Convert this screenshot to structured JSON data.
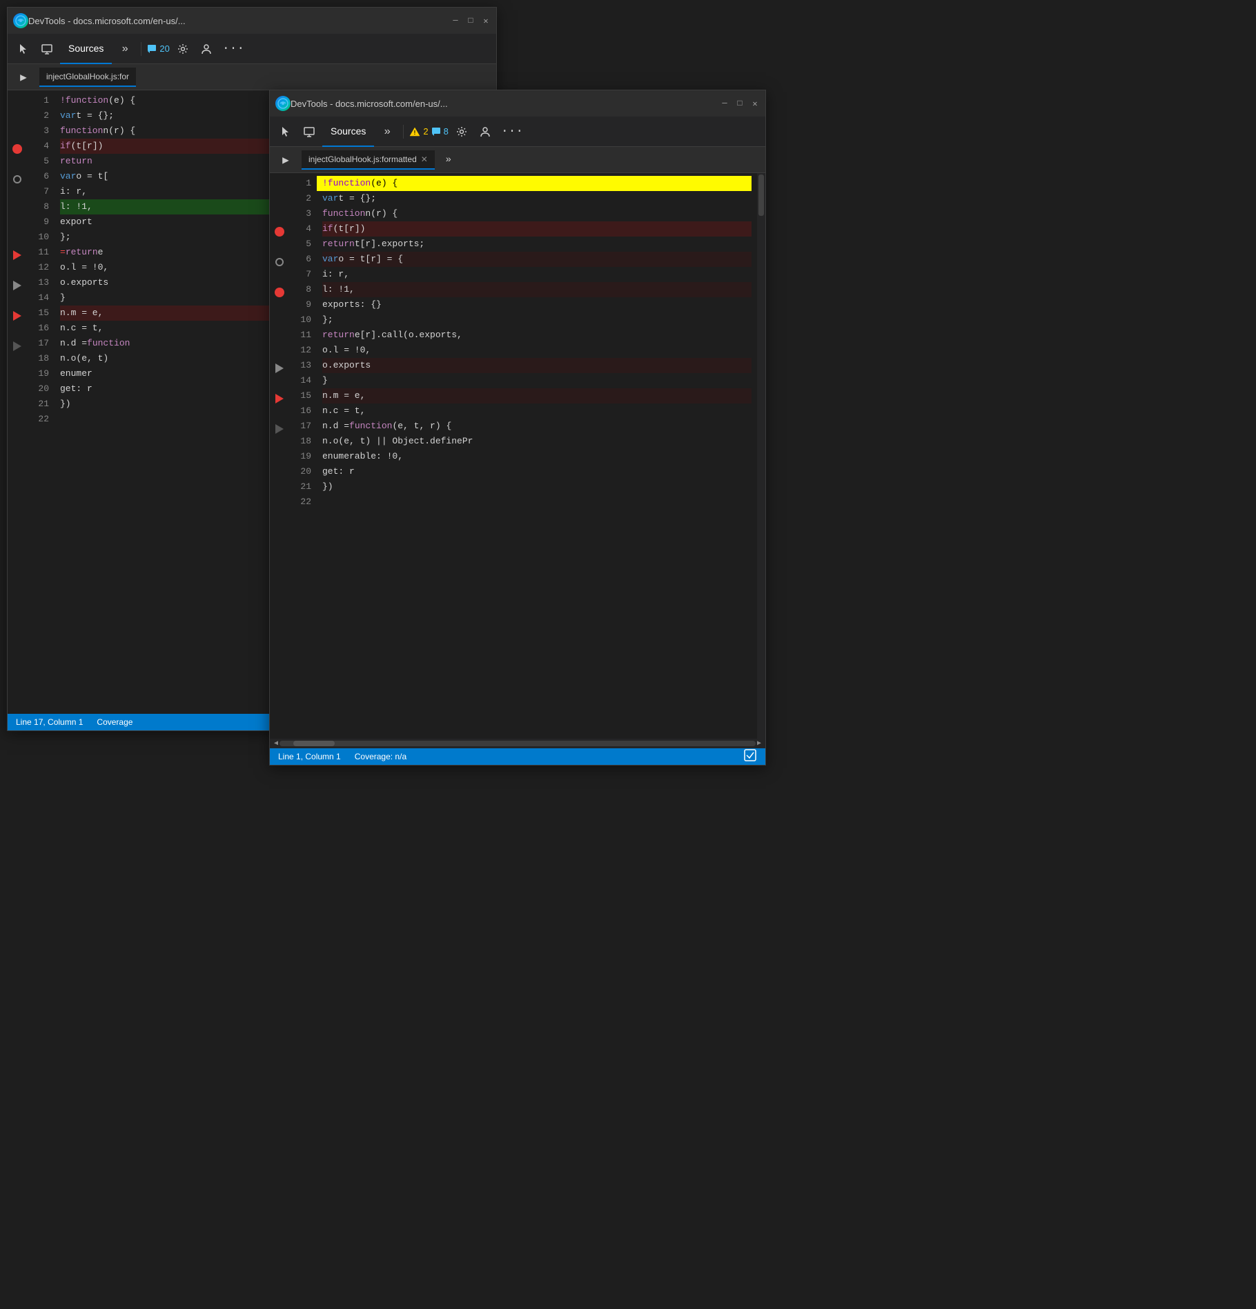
{
  "window_back": {
    "title": "DevTools - docs.microsoft.com/en-us/...",
    "tab_sources": "Sources",
    "badge_count": "20",
    "file_tab_name": "injectGlobalHook.js:for",
    "status_position": "Line 17, Column 1",
    "status_coverage": "Coverage",
    "code_lines": [
      {
        "num": 1,
        "bp": "none",
        "highlight": "none",
        "content": "!function(e) {"
      },
      {
        "num": 2,
        "bp": "none",
        "highlight": "none",
        "content": "    var t = {};"
      },
      {
        "num": 3,
        "bp": "none",
        "highlight": "none",
        "content": "    function n(r) {"
      },
      {
        "num": 4,
        "bp": "red",
        "highlight": "breakpoint",
        "content": "        if (t[r])"
      },
      {
        "num": 5,
        "bp": "none",
        "highlight": "none",
        "content": "            return"
      },
      {
        "num": 6,
        "bp": "gray",
        "highlight": "none",
        "content": "        var o = t["
      },
      {
        "num": 7,
        "bp": "none",
        "highlight": "none",
        "content": "            i: r,"
      },
      {
        "num": 8,
        "bp": "none",
        "highlight": "green",
        "content": "            l: !1,"
      },
      {
        "num": 9,
        "bp": "none",
        "highlight": "none",
        "content": "            export"
      },
      {
        "num": 10,
        "bp": "none",
        "highlight": "none",
        "content": "        };"
      },
      {
        "num": 11,
        "bp": "arrow-red",
        "highlight": "none",
        "content": "=return e"
      },
      {
        "num": 12,
        "bp": "none",
        "highlight": "none",
        "content": "        o.l = !0,"
      },
      {
        "num": 13,
        "bp": "arrow-gray",
        "highlight": "none",
        "content": "        o.exports"
      },
      {
        "num": 14,
        "bp": "none",
        "highlight": "none",
        "content": "    }"
      },
      {
        "num": 15,
        "bp": "arrow-red",
        "highlight": "breakpoint",
        "content": "    n.m = e,"
      },
      {
        "num": 16,
        "bp": "none",
        "highlight": "none",
        "content": "    n.c = t,"
      },
      {
        "num": 17,
        "bp": "arrow-outline",
        "highlight": "none",
        "content": "    n.d = function"
      },
      {
        "num": 18,
        "bp": "none",
        "highlight": "none",
        "content": "        n.o(e, t)"
      },
      {
        "num": 19,
        "bp": "none",
        "highlight": "none",
        "content": "            enumer"
      },
      {
        "num": 20,
        "bp": "none",
        "highlight": "none",
        "content": "            get: r"
      },
      {
        "num": 21,
        "bp": "none",
        "highlight": "none",
        "content": "    })"
      },
      {
        "num": 22,
        "bp": "none",
        "highlight": "none",
        "content": ""
      }
    ]
  },
  "window_front": {
    "title": "DevTools - docs.microsoft.com/en-us/...",
    "tab_sources": "Sources",
    "badge_warning": "2",
    "badge_messages": "8",
    "file_tab_name": "injectGlobalHook.js:formatted",
    "status_position": "Line 1, Column 1",
    "status_coverage": "Coverage: n/a",
    "code_lines": [
      {
        "num": 1,
        "bp": "none",
        "highlight": "yellow",
        "content_parts": [
          {
            "t": "kw",
            "v": "!function"
          },
          {
            "t": "plain",
            "v": "(e) {"
          }
        ]
      },
      {
        "num": 2,
        "bp": "none",
        "highlight": "none",
        "content_parts": [
          {
            "t": "plain",
            "v": "        "
          },
          {
            "t": "kw2",
            "v": "var"
          },
          {
            "t": "plain",
            "v": " t = {};"
          }
        ]
      },
      {
        "num": 3,
        "bp": "none",
        "highlight": "none",
        "content_parts": [
          {
            "t": "plain",
            "v": "        "
          },
          {
            "t": "kw",
            "v": "function"
          },
          {
            "t": "plain",
            "v": " n(r) {"
          }
        ]
      },
      {
        "num": 4,
        "bp": "red",
        "highlight": "breakpoint",
        "content_parts": [
          {
            "t": "plain",
            "v": "            "
          },
          {
            "t": "kw",
            "v": "if"
          },
          {
            "t": "plain",
            "v": " (t[r])"
          }
        ]
      },
      {
        "num": 5,
        "bp": "none",
        "highlight": "none",
        "content_parts": [
          {
            "t": "plain",
            "v": "                "
          },
          {
            "t": "kw",
            "v": "return"
          },
          {
            "t": "plain",
            "v": " t[r].exports;"
          }
        ]
      },
      {
        "num": 6,
        "bp": "gray",
        "highlight": "breakpoint-light",
        "content_parts": [
          {
            "t": "plain",
            "v": "            "
          },
          {
            "t": "kw2",
            "v": "var"
          },
          {
            "t": "plain",
            "v": " o = t[r] = {"
          }
        ]
      },
      {
        "num": 7,
        "bp": "none",
        "highlight": "none",
        "content_parts": [
          {
            "t": "plain",
            "v": "                i: r,"
          }
        ]
      },
      {
        "num": 8,
        "bp": "red",
        "highlight": "breakpoint-light",
        "content_parts": [
          {
            "t": "plain",
            "v": "                l: !1,"
          }
        ]
      },
      {
        "num": 9,
        "bp": "none",
        "highlight": "none",
        "content_parts": [
          {
            "t": "plain",
            "v": "                exports: {}"
          }
        ]
      },
      {
        "num": 10,
        "bp": "none",
        "highlight": "none",
        "content_parts": [
          {
            "t": "plain",
            "v": "            };"
          }
        ]
      },
      {
        "num": 11,
        "bp": "none",
        "highlight": "none",
        "content_parts": [
          {
            "t": "plain",
            "v": "            "
          },
          {
            "t": "kw",
            "v": "return"
          },
          {
            "t": "plain",
            "v": " e[r].call(o.exports,"
          }
        ]
      },
      {
        "num": 12,
        "bp": "none",
        "highlight": "none",
        "content_parts": [
          {
            "t": "plain",
            "v": "            o.l = !0,"
          }
        ]
      },
      {
        "num": 13,
        "bp": "arrow-gray",
        "highlight": "breakpoint-light",
        "content_parts": [
          {
            "t": "plain",
            "v": "            o.exports"
          }
        ]
      },
      {
        "num": 14,
        "bp": "none",
        "highlight": "none",
        "content_parts": [
          {
            "t": "plain",
            "v": "        }"
          }
        ]
      },
      {
        "num": 15,
        "bp": "arrow-red",
        "highlight": "breakpoint-light",
        "content_parts": [
          {
            "t": "plain",
            "v": "        n.m = e,"
          }
        ]
      },
      {
        "num": 16,
        "bp": "none",
        "highlight": "none",
        "content_parts": [
          {
            "t": "plain",
            "v": "        n.c = t,"
          }
        ]
      },
      {
        "num": 17,
        "bp": "arrow-outline",
        "highlight": "none",
        "content_parts": [
          {
            "t": "plain",
            "v": "        n.d = "
          },
          {
            "t": "kw",
            "v": "function"
          },
          {
            "t": "plain",
            "v": "(e, t, r) {"
          }
        ]
      },
      {
        "num": 18,
        "bp": "none",
        "highlight": "none",
        "content_parts": [
          {
            "t": "plain",
            "v": "            n.o(e, t) || Object.definePr"
          }
        ]
      },
      {
        "num": 19,
        "bp": "none",
        "highlight": "none",
        "content_parts": [
          {
            "t": "plain",
            "v": "                enumerable: !0,"
          }
        ]
      },
      {
        "num": 20,
        "bp": "none",
        "highlight": "none",
        "content_parts": [
          {
            "t": "plain",
            "v": "                get: r"
          }
        ]
      },
      {
        "num": 21,
        "bp": "none",
        "highlight": "none",
        "content_parts": [
          {
            "t": "plain",
            "v": "        })"
          }
        ]
      },
      {
        "num": 22,
        "bp": "none",
        "highlight": "none",
        "content_parts": [
          {
            "t": "plain",
            "v": ""
          }
        ]
      }
    ]
  },
  "icons": {
    "cursor": "⬚",
    "screen": "🖥",
    "gear": "⚙",
    "person": "👤",
    "more": "…",
    "chevron_right": "»",
    "sidebar_toggle": "▶",
    "close": "✕",
    "minimize": "─",
    "maximize": "□",
    "arrow_up": "↑",
    "arrow_down": "↓"
  }
}
